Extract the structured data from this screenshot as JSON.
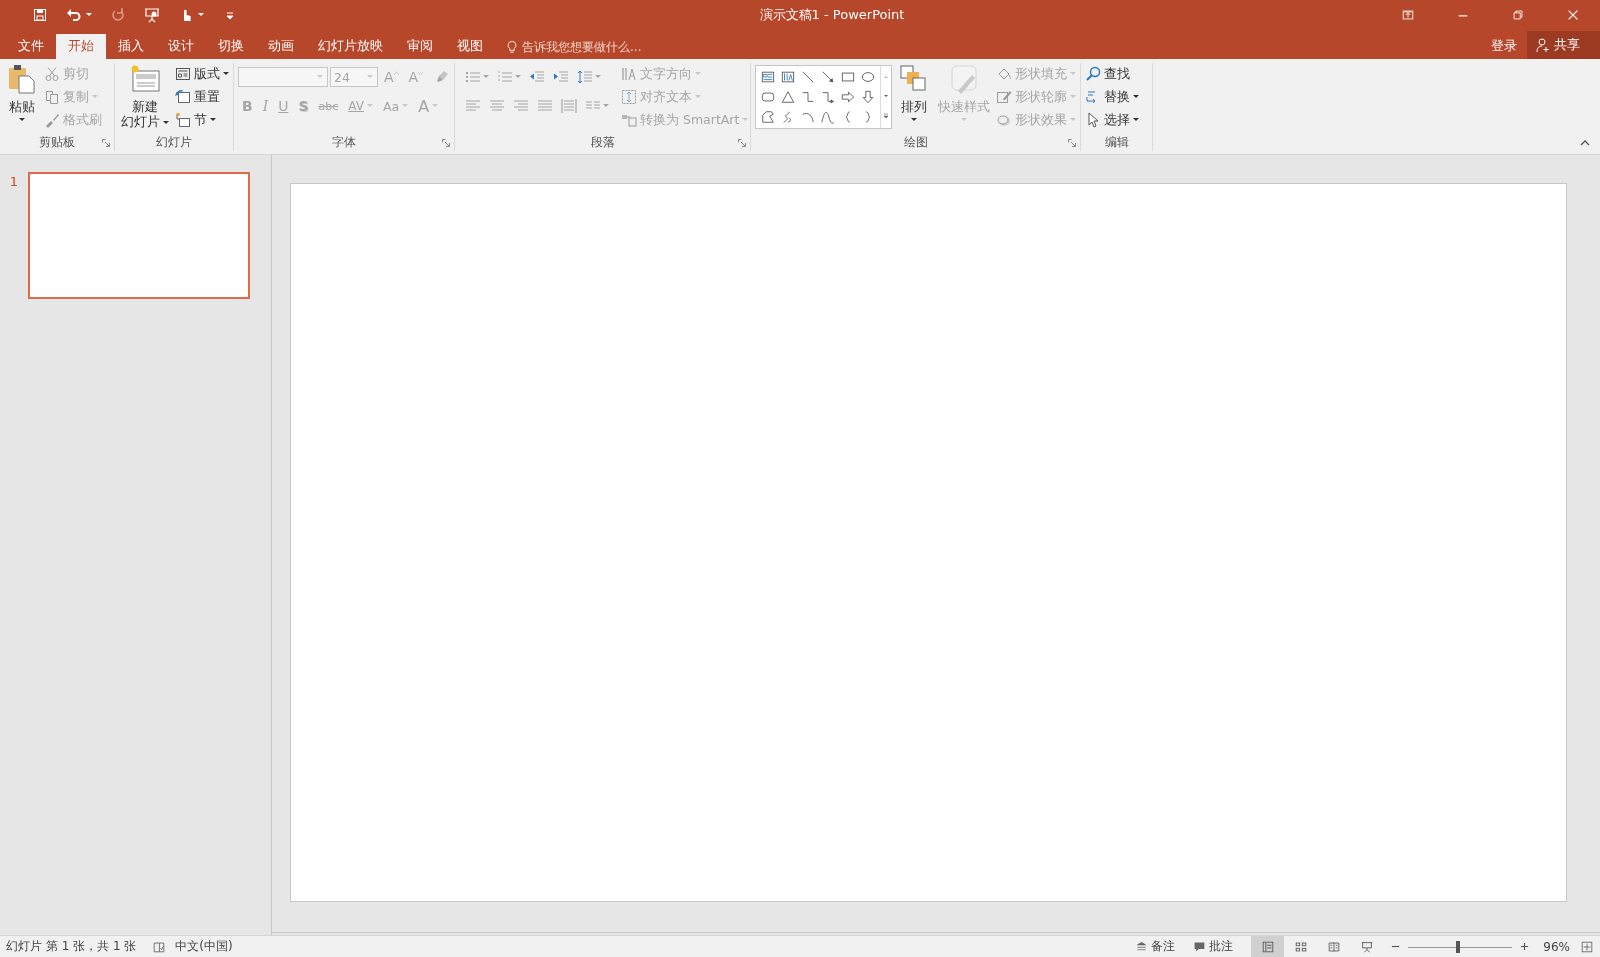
{
  "window": {
    "title": "演示文稿1 - PowerPoint"
  },
  "quick_access": [
    {
      "disabled": false,
      "dropdown": false
    },
    {
      "disabled": false,
      "dropdown": true
    },
    {
      "disabled": true,
      "dropdown": false
    },
    {
      "disabled": false,
      "dropdown": false
    },
    {
      "disabled": false,
      "dropdown": true
    },
    {
      "disabled": false,
      "dropdown": false
    }
  ],
  "tabs": [
    {
      "label": "文件",
      "selected": false
    },
    {
      "label": "开始",
      "selected": true
    },
    {
      "label": "插入",
      "selected": false
    },
    {
      "label": "设计",
      "selected": false
    },
    {
      "label": "切换",
      "selected": false
    },
    {
      "label": "动画",
      "selected": false
    },
    {
      "label": "幻灯片放映",
      "selected": false
    },
    {
      "label": "审阅",
      "selected": false
    },
    {
      "label": "视图",
      "selected": false
    }
  ],
  "tell_me": {
    "placeholder": "告诉我您想要做什么..."
  },
  "account": {
    "sign_in": "登录",
    "share": "共享"
  },
  "ribbon": {
    "groups": [
      {
        "label": "剪贴板",
        "launcher": true,
        "sections": [
          {
            "kind": "large",
            "label_lines": [
              "粘贴"
            ],
            "dropdown": true,
            "disabled": false
          },
          {
            "kind": "stack",
            "items": [
              {
                "kind": "small",
                "label": "剪切",
                "disabled": true,
                "dropdown": false
              },
              {
                "kind": "small",
                "label": "复制",
                "disabled": true,
                "dropdown": true
              },
              {
                "kind": "small",
                "label": "格式刷",
                "disabled": true,
                "dropdown": false
              }
            ]
          }
        ]
      },
      {
        "label": "幻灯片",
        "launcher": false,
        "sections": [
          {
            "kind": "large",
            "label_lines": [
              "新建",
              "幻灯片"
            ],
            "dropdown": true,
            "disabled": false
          },
          {
            "kind": "stack",
            "items": [
              {
                "kind": "small",
                "label": "版式",
                "disabled": false,
                "dropdown": true
              },
              {
                "kind": "small",
                "label": "重置",
                "disabled": false,
                "dropdown": false
              },
              {
                "kind": "small",
                "label": "节",
                "disabled": false,
                "dropdown": true
              }
            ]
          }
        ]
      },
      {
        "label": "字体",
        "launcher": true,
        "sections": [
          {
            "kind": "stack",
            "items": [
              {
                "kind": "row",
                "controls": [
                  {
                    "kind": "combo",
                    "disabled": true
                  },
                  {
                    "kind": "combo",
                    "value": "24",
                    "disabled": true
                  },
                  {
                    "kind": "glyph",
                    "text": "A",
                    "disabled": true,
                    "dropdown": false
                  },
                  {
                    "kind": "glyph",
                    "text": "A",
                    "disabled": true,
                    "dropdown": false
                  },
                  {
                    "kind": "icon",
                    "disabled": true,
                    "dropdown": false
                  }
                ]
              },
              {
                "kind": "row",
                "controls": [
                  {
                    "kind": "glyph",
                    "text": "B",
                    "disabled": true,
                    "dropdown": false
                  },
                  {
                    "kind": "glyph",
                    "text": "I",
                    "disabled": true,
                    "dropdown": false
                  },
                  {
                    "kind": "glyph",
                    "text": "U",
                    "disabled": true,
                    "dropdown": false
                  },
                  {
                    "kind": "glyph",
                    "text": "S",
                    "disabled": true,
                    "dropdown": false
                  },
                  {
                    "kind": "glyph",
                    "text": "abc",
                    "disabled": true,
                    "dropdown": false
                  },
                  {
                    "kind": "glyph",
                    "text": "AV",
                    "disabled": true,
                    "dropdown": true
                  },
                  {
                    "kind": "glyph",
                    "text": "Aa",
                    "disabled": true,
                    "dropdown": true
                  },
                  {
                    "kind": "glyph",
                    "text": "A",
                    "disabled": true,
                    "dropdown": true
                  }
                ]
              }
            ]
          }
        ]
      },
      {
        "label": "段落",
        "launcher": true,
        "sections": [
          {
            "kind": "stack",
            "items": [
              {
                "kind": "row",
                "controls": [
                  {
                    "kind": "icon",
                    "disabled": true,
                    "dropdown": true
                  },
                  {
                    "kind": "icon",
                    "disabled": true,
                    "dropdown": true
                  },
                  {
                    "kind": "icon",
                    "disabled": true,
                    "dropdown": false
                  },
                  {
                    "kind": "icon",
                    "disabled": true,
                    "dropdown": false
                  },
                  {
                    "kind": "icon",
                    "disabled": true,
                    "dropdown": true
                  }
                ]
              },
              {
                "kind": "row",
                "controls": [
                  {
                    "kind": "icon",
                    "disabled": true,
                    "dropdown": false
                  },
                  {
                    "kind": "icon",
                    "disabled": true,
                    "dropdown": false
                  },
                  {
                    "kind": "icon",
                    "disabled": true,
                    "dropdown": false
                  },
                  {
                    "kind": "icon",
                    "disabled": true,
                    "dropdown": false
                  },
                  {
                    "kind": "icon",
                    "disabled": true,
                    "dropdown": false
                  },
                  {
                    "kind": "icon",
                    "disabled": true,
                    "dropdown": true
                  }
                ]
              }
            ]
          },
          {
            "kind": "stack",
            "items": [
              {
                "kind": "small",
                "label": "文字方向",
                "disabled": true,
                "dropdown": true
              },
              {
                "kind": "small",
                "label": "对齐文本",
                "disabled": true,
                "dropdown": true
              },
              {
                "kind": "small",
                "label": "转换为 SmartArt",
                "disabled": true,
                "dropdown": true
              }
            ]
          }
        ]
      },
      {
        "label": "绘图",
        "launcher": true,
        "sections": [
          {
            "kind": "gallery"
          },
          {
            "kind": "large",
            "label_lines": [
              "排列"
            ],
            "dropdown": true,
            "disabled": false
          },
          {
            "kind": "large",
            "label_lines": [
              "快速样式"
            ],
            "dropdown": true,
            "disabled": true
          },
          {
            "kind": "stack",
            "items": [
              {
                "kind": "small",
                "label": "形状填充",
                "disabled": true,
                "dropdown": true
              },
              {
                "kind": "small",
                "label": "形状轮廓",
                "disabled": true,
                "dropdown": true
              },
              {
                "kind": "small",
                "label": "形状效果",
                "disabled": true,
                "dropdown": true
              }
            ]
          }
        ]
      },
      {
        "label": "编辑",
        "launcher": false,
        "sections": [
          {
            "kind": "stack",
            "items": [
              {
                "kind": "small",
                "label": "查找",
                "disabled": false,
                "dropdown": false
              },
              {
                "kind": "small",
                "label": "替换",
                "disabled": false,
                "dropdown": true
              },
              {
                "kind": "small",
                "label": "选择",
                "disabled": false,
                "dropdown": true
              }
            ]
          }
        ]
      }
    ]
  },
  "slides_pane": {
    "slides": [
      {
        "number": "1",
        "selected": true
      }
    ]
  },
  "status_bar": {
    "slide_info": "幻灯片 第 1 张，共 1 张",
    "language": "中文(中国)",
    "notes": "备注",
    "comments": "批注",
    "views": [
      {
        "selected": true
      },
      {
        "selected": false
      },
      {
        "selected": false
      },
      {
        "selected": false
      }
    ],
    "zoom": {
      "level": 0.48,
      "reading": "96%"
    }
  }
}
